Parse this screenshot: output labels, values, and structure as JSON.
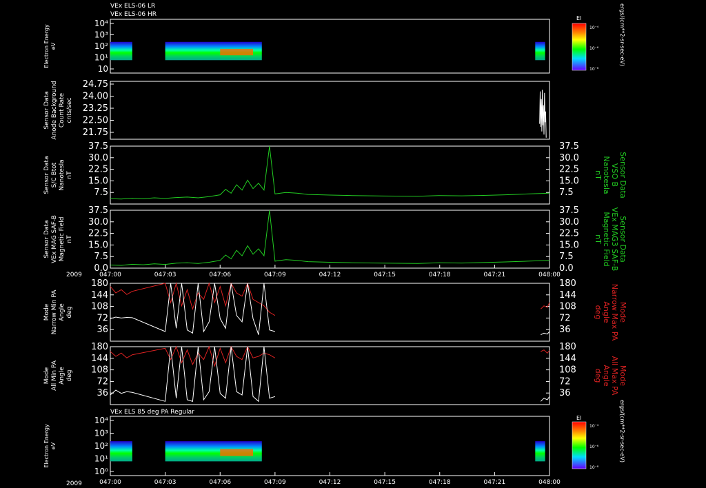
{
  "header": {
    "line1": "VEx ELS-06 LR",
    "line2": "VEx ELS-06 HR"
  },
  "colors": {
    "bg": "#000000",
    "frame": "#ffffff",
    "green": "#22cc22",
    "red": "#dd2222",
    "white": "#ffffff"
  },
  "colorbar": {
    "title": "El",
    "ticks": [
      "10⁻⁴",
      "10⁻⁶",
      "10⁻⁸"
    ],
    "unit": "ergs/(cm**2-sr-sec-eV)"
  },
  "time_axis": {
    "year": "2009",
    "ticks": [
      "047:00",
      "047:03",
      "047:06",
      "047:09",
      "047:12",
      "047:15",
      "047:18",
      "047:21",
      "048:00"
    ]
  },
  "chart_data": [
    {
      "type": "heatmap",
      "id": "spec1",
      "ylabel": [
        "Electron Energy",
        "eV"
      ],
      "yticks": [
        "10⁴",
        "10³",
        "10²",
        "10¹",
        "10"
      ],
      "ylog_range": [
        1,
        4
      ],
      "blocks": [
        [
          0.0,
          0.2
        ],
        [
          0.5,
          1.38
        ],
        [
          3.87,
          3.96
        ]
      ]
    },
    {
      "type": "line",
      "id": "anode",
      "ylabel": [
        "Sensor Data",
        "Anode Background",
        "Count Rate",
        "cnts/sec"
      ],
      "yticks": [
        "24.75",
        "24.00",
        "23.25",
        "22.50",
        "21.75"
      ],
      "ylim": [
        21.0,
        24.75
      ],
      "series": [
        {
          "color": "#ffffff",
          "x": [
            3.91,
            3.915,
            3.92,
            3.925,
            3.93,
            3.935,
            3.94,
            3.945,
            3.95,
            3.955,
            3.96,
            3.965,
            3.97
          ],
          "y": [
            22.0,
            24.1,
            21.8,
            23.6,
            21.5,
            24.2,
            21.9,
            23.2,
            21.3,
            24.0,
            22.1,
            22.8,
            21.1
          ]
        }
      ]
    },
    {
      "type": "line",
      "id": "bmag1",
      "ylabel": [
        "Sensor Data",
        "S/C Btot",
        "Nanotesla",
        "nT"
      ],
      "yticks": [
        "37.5",
        "30.0",
        "22.5",
        "15.0",
        "7.5"
      ],
      "yticks_right": [
        "37.5",
        "30.0",
        "22.5",
        "15.0",
        "7.5"
      ],
      "right_label": [
        "Sensor Data",
        "VSO B",
        "Nanotesla",
        "nT"
      ],
      "ylim": [
        0,
        37.5
      ],
      "series": [
        {
          "color": "#22cc22",
          "x": [
            0.0,
            0.1,
            0.2,
            0.3,
            0.4,
            0.5,
            0.6,
            0.7,
            0.8,
            0.9,
            1.0,
            1.05,
            1.1,
            1.15,
            1.2,
            1.25,
            1.3,
            1.35,
            1.4,
            1.45,
            1.5,
            1.55,
            1.6,
            1.7,
            1.8,
            2.0,
            2.2,
            2.5,
            2.8,
            3.0,
            3.2,
            3.4,
            3.6,
            3.8,
            4.0
          ],
          "y": [
            3.5,
            3.2,
            3.8,
            3.4,
            4.0,
            3.6,
            4.2,
            4.5,
            4.0,
            4.8,
            6.0,
            9.5,
            7.0,
            12.5,
            9.0,
            15.5,
            10.0,
            13.5,
            9.0,
            37.5,
            6.5,
            7.0,
            7.5,
            7.0,
            6.2,
            5.8,
            5.5,
            5.2,
            5.0,
            5.5,
            5.3,
            5.6,
            6.0,
            6.5,
            7.0
          ]
        }
      ]
    },
    {
      "type": "line",
      "id": "bmag2",
      "ylabel": [
        "Sensor Data",
        "VEx MAG SAF-B",
        "Magnetic Field",
        "nT"
      ],
      "yticks": [
        "37.5",
        "30.0",
        "22.5",
        "15.0",
        "7.5",
        "0.0"
      ],
      "yticks_right": [
        "37.5",
        "30.0",
        "22.5",
        "15.0",
        "7.5",
        "0.0"
      ],
      "right_label": [
        "Sensor Data",
        "VEx MAG3 SAF-B",
        "Magnetic Field",
        "nT"
      ],
      "ylim": [
        0,
        37.5
      ],
      "series": [
        {
          "color": "#22cc22",
          "x": [
            0.0,
            0.1,
            0.2,
            0.3,
            0.4,
            0.5,
            0.6,
            0.7,
            0.8,
            0.9,
            1.0,
            1.05,
            1.1,
            1.15,
            1.2,
            1.25,
            1.3,
            1.35,
            1.4,
            1.45,
            1.5,
            1.55,
            1.6,
            1.7,
            1.8,
            2.0,
            2.2,
            2.5,
            2.8,
            3.0,
            3.2,
            3.4,
            3.6,
            3.8,
            4.0
          ],
          "y": [
            2.0,
            1.8,
            2.5,
            2.2,
            2.8,
            2.4,
            3.2,
            3.5,
            3.0,
            3.8,
            5.0,
            8.5,
            6.0,
            11.5,
            8.0,
            14.5,
            9.0,
            12.5,
            8.0,
            37.5,
            4.5,
            5.0,
            5.5,
            5.0,
            4.2,
            3.8,
            3.5,
            3.2,
            3.0,
            3.5,
            3.3,
            3.6,
            4.0,
            4.5,
            5.0
          ]
        }
      ]
    },
    {
      "type": "line",
      "id": "pa_narrow",
      "ylabel": [
        "Mode",
        "Narrow Min PA",
        "Angle",
        "deg"
      ],
      "right_label": [
        "Mode",
        "Narrow Max PA",
        "Angle",
        "deg"
      ],
      "yticks": [
        "180",
        "144",
        "108",
        "72",
        "36"
      ],
      "yticks_right": [
        "180",
        "144",
        "108",
        "72",
        "36"
      ],
      "ylim": [
        0,
        180
      ],
      "series": [
        {
          "color": "#dd2222",
          "x": [
            0.0,
            0.05,
            0.1,
            0.15,
            0.2,
            0.5,
            0.55,
            0.6,
            0.65,
            0.7,
            0.75,
            0.8,
            0.85,
            0.9,
            0.95,
            1.0,
            1.05,
            1.1,
            1.15,
            1.2,
            1.25,
            1.3,
            1.35,
            1.4,
            1.45,
            1.5
          ],
          "y": [
            170,
            150,
            160,
            145,
            155,
            180,
            120,
            180,
            110,
            160,
            100,
            150,
            130,
            180,
            120,
            170,
            110,
            180,
            150,
            140,
            180,
            130,
            120,
            110,
            90,
            80
          ]
        },
        {
          "color": "#dd2222",
          "x": [
            3.92,
            3.95,
            3.98,
            4.0
          ],
          "y": [
            100,
            110,
            105,
            120
          ]
        },
        {
          "color": "#ffffff",
          "x": [
            0.0,
            0.05,
            0.1,
            0.15,
            0.2,
            0.5,
            0.55,
            0.6,
            0.65,
            0.7,
            0.75,
            0.8,
            0.85,
            0.9,
            0.95,
            1.0,
            1.05,
            1.1,
            1.15,
            1.2,
            1.25,
            1.3,
            1.35,
            1.4,
            1.45,
            1.5
          ],
          "y": [
            70,
            75,
            72,
            74,
            73,
            30,
            180,
            40,
            180,
            35,
            25,
            180,
            30,
            60,
            180,
            70,
            40,
            180,
            80,
            60,
            180,
            70,
            20,
            180,
            35,
            30
          ]
        },
        {
          "color": "#ffffff",
          "x": [
            3.92,
            3.95,
            3.98,
            4.0
          ],
          "y": [
            20,
            25,
            22,
            30
          ]
        }
      ]
    },
    {
      "type": "line",
      "id": "pa_all",
      "ylabel": [
        "Mode",
        "All Min PA",
        "Angle",
        "deg"
      ],
      "right_label": [
        "Mode",
        "All Max PA",
        "Angle",
        "deg"
      ],
      "yticks": [
        "180",
        "144",
        "108",
        "72",
        "36"
      ],
      "yticks_right": [
        "180",
        "144",
        "108",
        "72",
        "36"
      ],
      "ylim": [
        0,
        180
      ],
      "series": [
        {
          "color": "#dd2222",
          "x": [
            0.0,
            0.05,
            0.1,
            0.15,
            0.2,
            0.5,
            0.55,
            0.6,
            0.65,
            0.7,
            0.75,
            0.8,
            0.85,
            0.9,
            0.95,
            1.0,
            1.05,
            1.1,
            1.15,
            1.2,
            1.25,
            1.3,
            1.35,
            1.4,
            1.45,
            1.5
          ],
          "y": [
            165,
            150,
            160,
            145,
            155,
            175,
            140,
            180,
            130,
            170,
            125,
            160,
            140,
            180,
            120,
            175,
            130,
            180,
            150,
            140,
            180,
            145,
            150,
            160,
            155,
            145
          ]
        },
        {
          "color": "#dd2222",
          "x": [
            3.92,
            3.95,
            3.98,
            4.0
          ],
          "y": [
            165,
            170,
            160,
            168
          ]
        },
        {
          "color": "#ffffff",
          "x": [
            0.0,
            0.05,
            0.1,
            0.15,
            0.2,
            0.5,
            0.55,
            0.6,
            0.65,
            0.7,
            0.75,
            0.8,
            0.85,
            0.9,
            0.95,
            1.0,
            1.05,
            1.1,
            1.15,
            1.2,
            1.25,
            1.3,
            1.35,
            1.4,
            1.45,
            1.5
          ],
          "y": [
            30,
            45,
            35,
            40,
            38,
            10,
            180,
            20,
            180,
            15,
            10,
            180,
            15,
            40,
            180,
            35,
            20,
            180,
            40,
            30,
            180,
            25,
            10,
            180,
            20,
            25
          ]
        },
        {
          "color": "#ffffff",
          "x": [
            3.92,
            3.95,
            3.98,
            4.0
          ],
          "y": [
            10,
            20,
            15,
            25
          ]
        }
      ]
    },
    {
      "type": "heatmap",
      "id": "spec2",
      "title": "VEx ELS 85 deg PA Regular",
      "ylabel": [
        "Electron Energy",
        "eV"
      ],
      "yticks": [
        "10⁴",
        "10³",
        "10²",
        "10¹",
        "10⁰"
      ],
      "ylog_range": [
        0,
        4
      ],
      "blocks": [
        [
          0.0,
          0.2
        ],
        [
          0.5,
          1.38
        ],
        [
          3.87,
          3.96
        ]
      ]
    }
  ]
}
